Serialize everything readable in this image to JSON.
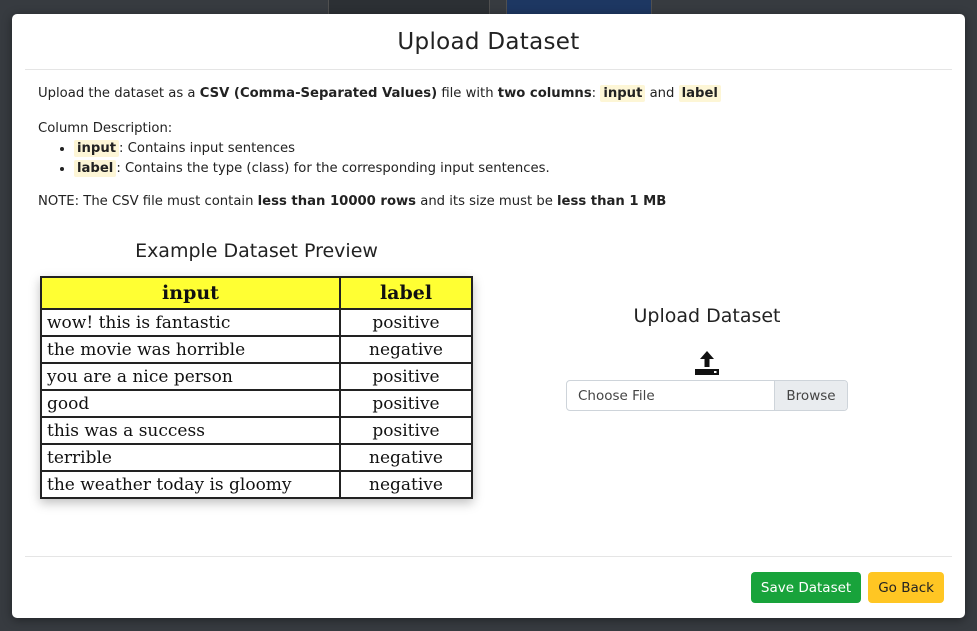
{
  "background": {
    "tabs": [
      "",
      ""
    ],
    "bottom_labels": [
      "",
      ""
    ]
  },
  "modal": {
    "title": "Upload Dataset",
    "description": {
      "prefix": "Upload the dataset as a ",
      "format": "CSV (Comma-Separated Values)",
      "mid": " file with ",
      "columns_phrase": "two columns",
      "colon": ":",
      "col_input": "input",
      "and": "and",
      "col_label": "label"
    },
    "column_description": {
      "heading": "Column Description:",
      "items": [
        {
          "name": "input",
          "text": ": Contains input sentences"
        },
        {
          "name": "label",
          "text": ": Contains the type (class) for the corresponding input sentences."
        }
      ]
    },
    "note": {
      "prefix": "NOTE: The CSV file must contain ",
      "rows": "less than 10000 rows",
      "mid": " and its size must be ",
      "size": "less than 1 MB"
    },
    "preview": {
      "title": "Example Dataset Preview",
      "headers": [
        "input",
        "label"
      ],
      "rows": [
        [
          "wow! this is fantastic",
          "positive"
        ],
        [
          "the movie was horrible",
          "negative"
        ],
        [
          "you are a nice person",
          "positive"
        ],
        [
          "good",
          "positive"
        ],
        [
          "this was a success",
          "positive"
        ],
        [
          "terrible",
          "negative"
        ],
        [
          "the weather today is gloomy",
          "negative"
        ]
      ]
    },
    "upload": {
      "title": "Upload Dataset",
      "icon": "upload-icon",
      "file_placeholder": "Choose File",
      "browse_label": "Browse"
    },
    "footer": {
      "save_label": "Save Dataset",
      "back_label": "Go Back"
    }
  },
  "colors": {
    "save": "#18a33b",
    "back": "#ffc623",
    "table_header": "#ffff33",
    "highlight": "#fdf6d6"
  }
}
